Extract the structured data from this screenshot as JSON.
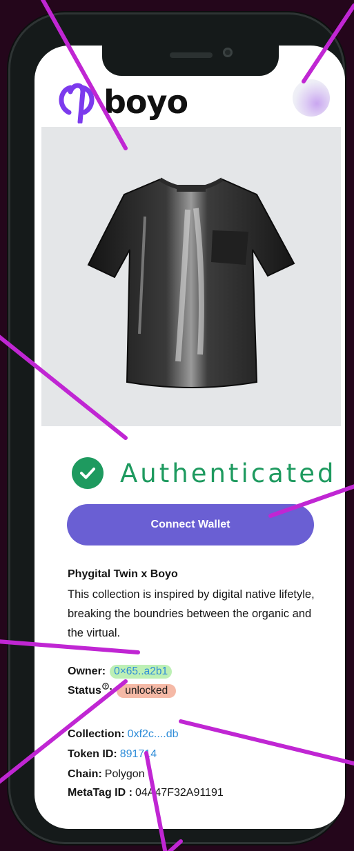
{
  "brand": {
    "name": "boyo",
    "logo_icon": "phi-logo-icon",
    "accent": "#7c3aed"
  },
  "profile": {
    "icon": "avatar-gradient-icon"
  },
  "product": {
    "image": "black-sequin-tshirt"
  },
  "status_banner": {
    "text": "Authenticated",
    "icon": "check-circle-icon",
    "color": "#1e9a5f"
  },
  "actions": {
    "connect_label": "Connect Wallet",
    "color": "#6a5fd3"
  },
  "collection_info": {
    "title": "Phygital Twin x Boyo",
    "description": "This collection is inspired by digital native lifetyle, breaking the boundries between the organic and the virtual."
  },
  "details": {
    "owner_label": "Owner:",
    "owner_value": "0×65..a2b1",
    "status_label": "Status",
    "status_help_icon": "question-circle-icon",
    "status_colon": ":",
    "status_value": "unlocked",
    "collection_label": "Collection:",
    "collection_value": "0xf2c....db",
    "token_label": "Token ID:",
    "token_value": "891714",
    "chain_label": "Chain:",
    "chain_value": "Polygon",
    "metatag_label": "MetaTag ID :",
    "metatag_value": "04A47F32A91191"
  },
  "annotations": {
    "line_color": "#c026d3"
  }
}
